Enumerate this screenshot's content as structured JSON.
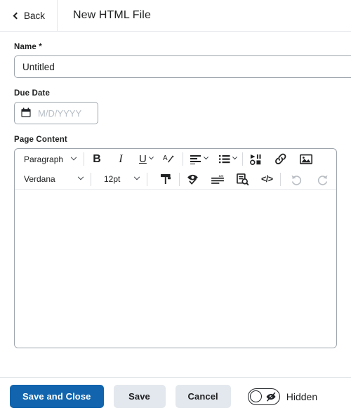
{
  "header": {
    "back_label": "Back",
    "back_icon": "chevron-left-icon",
    "title": "New HTML File"
  },
  "form": {
    "name": {
      "label": "Name *",
      "value": "Untitled",
      "placeholder": ""
    },
    "due_date": {
      "label": "Due Date",
      "value": "",
      "placeholder": "M/D/YYYY",
      "icon": "calendar-icon"
    },
    "page_content": {
      "label": "Page Content"
    }
  },
  "editor": {
    "toolbar_row1": {
      "paragraph_style": "Paragraph",
      "bold": "B",
      "italic": "I",
      "underline": "U",
      "text_color_icon": "text-color-icon",
      "align_icon": "align-left-icon",
      "list_icon": "bulleted-list-icon",
      "media_icon": "insert-media-icon",
      "link_icon": "insert-link-icon",
      "image_icon": "insert-image-icon"
    },
    "toolbar_row2": {
      "font_family": "Verdana",
      "font_size": "12pt",
      "format_painter_icon": "format-painter-icon",
      "accessibility_icon": "accessibility-checker-icon",
      "word_count_icon": "word-count-icon",
      "preview_icon": "preview-icon",
      "source_code": "</>",
      "undo_icon": "undo-icon",
      "redo_icon": "redo-icon"
    },
    "content": ""
  },
  "footer": {
    "save_and_close": "Save and Close",
    "save": "Save",
    "cancel": "Cancel",
    "visibility_label": "Hidden",
    "visibility_icon": "eye-off-icon",
    "visibility_state": "off"
  },
  "colors": {
    "primary": "#1164ad",
    "secondary": "#e3e8ee",
    "border": "#9ea5ad",
    "text": "#202122",
    "placeholder": "#b6bec6"
  }
}
